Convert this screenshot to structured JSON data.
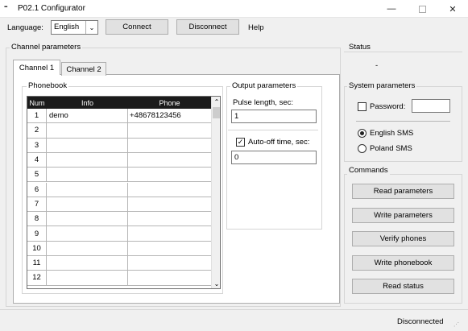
{
  "window": {
    "title": "P02.1 Configurator",
    "icon": "app-icon"
  },
  "toolbar": {
    "language_label": "Language:",
    "language_value": "English",
    "connect_label": "Connect",
    "disconnect_label": "Disconnect",
    "help_label": "Help"
  },
  "channel_params": {
    "group_label": "Channel parameters",
    "tabs": [
      {
        "label": "Channel 1",
        "active": true
      },
      {
        "label": "Channel 2",
        "active": false
      }
    ],
    "phonebook": {
      "group_label": "Phonebook",
      "columns": [
        "Num",
        "Info",
        "Phone"
      ],
      "rows": [
        {
          "num": "1",
          "info": "demo",
          "phone": "+48678123456"
        },
        {
          "num": "2",
          "info": "",
          "phone": ""
        },
        {
          "num": "3",
          "info": "",
          "phone": ""
        },
        {
          "num": "4",
          "info": "",
          "phone": ""
        },
        {
          "num": "5",
          "info": "",
          "phone": ""
        },
        {
          "num": "6",
          "info": "",
          "phone": ""
        },
        {
          "num": "7",
          "info": "",
          "phone": ""
        },
        {
          "num": "8",
          "info": "",
          "phone": ""
        },
        {
          "num": "9",
          "info": "",
          "phone": ""
        },
        {
          "num": "10",
          "info": "",
          "phone": ""
        },
        {
          "num": "11",
          "info": "",
          "phone": ""
        },
        {
          "num": "12",
          "info": "",
          "phone": ""
        }
      ]
    },
    "output": {
      "group_label": "Output parameters",
      "pulse_label": "Pulse length, sec:",
      "pulse_value": "1",
      "autooff_label": "Auto-off time, sec:",
      "autooff_checked": true,
      "autooff_value": "0"
    }
  },
  "status": {
    "group_label": "Status",
    "value": "-"
  },
  "system_params": {
    "group_label": "System parameters",
    "password_label": "Password:",
    "password_checked": false,
    "password_value": "",
    "sms_options": [
      {
        "label": "English SMS",
        "selected": true
      },
      {
        "label": "Poland SMS",
        "selected": false
      }
    ]
  },
  "commands": {
    "group_label": "Commands",
    "buttons": [
      "Read parameters",
      "Write parameters",
      "Verify phones",
      "Write phonebook",
      "Read status"
    ]
  },
  "statusbar": {
    "connection": "Disconnected"
  }
}
